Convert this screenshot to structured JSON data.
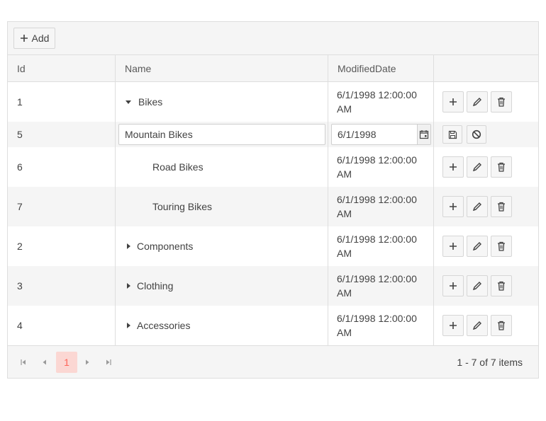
{
  "toolbar": {
    "add_label": "Add"
  },
  "columns": {
    "id": "Id",
    "name": "Name",
    "date": "ModifiedDate"
  },
  "rows": [
    {
      "id": "1",
      "name": "Bikes",
      "date": "6/1/1998 12:00:00 AM",
      "expanded": true
    },
    {
      "id": "5",
      "name": "Mountain Bikes",
      "date": "6/1/1998",
      "editing": true
    },
    {
      "id": "6",
      "name": "Road Bikes",
      "date": "6/1/1998 12:00:00 AM"
    },
    {
      "id": "7",
      "name": "Touring Bikes",
      "date": "6/1/1998 12:00:00 AM"
    },
    {
      "id": "2",
      "name": "Components",
      "date": "6/1/1998 12:00:00 AM",
      "expanded": false
    },
    {
      "id": "3",
      "name": "Clothing",
      "date": "6/1/1998 12:00:00 AM",
      "expanded": false
    },
    {
      "id": "4",
      "name": "Accessories",
      "date": "6/1/1998 12:00:00 AM",
      "expanded": false
    }
  ],
  "pager": {
    "current_page": "1",
    "info": "1 - 7 of 7 items"
  },
  "icons": {
    "add": "plus-icon",
    "edit": "pencil-icon",
    "delete": "trash-icon",
    "save": "save-icon",
    "cancel": "cancel-icon",
    "calendar": "calendar-icon",
    "expanded": "caret-down-icon",
    "collapsed": "caret-right-icon"
  },
  "colors": {
    "accent": "#ff6358",
    "accent_bg": "#fbd7d3",
    "border": "#dedede",
    "alt_row": "#f5f5f5"
  }
}
